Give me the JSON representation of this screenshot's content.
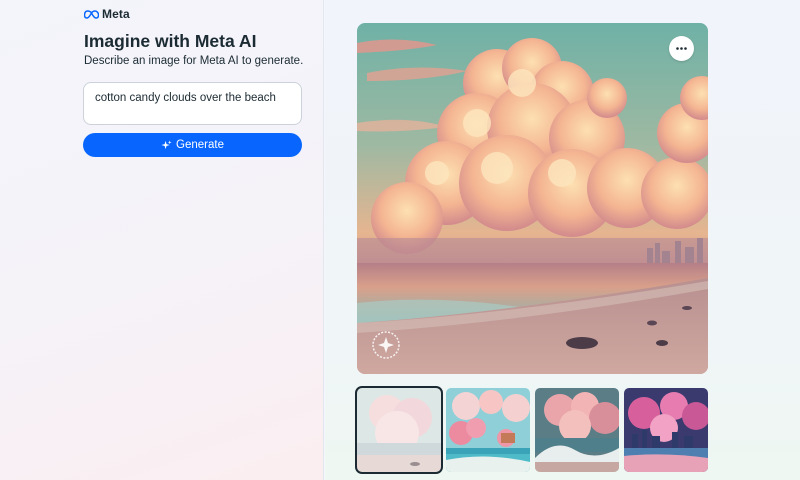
{
  "brand": {
    "logo_text": "Meta",
    "logo_icon": "meta-infinity-icon"
  },
  "header": {
    "title": "Imagine with Meta AI",
    "subtitle": "Describe an image for Meta AI to generate."
  },
  "prompt": {
    "value": "cotton candy clouds over the beach"
  },
  "generate_button": {
    "label": "Generate",
    "icon": "sparkle-icon"
  },
  "main_image": {
    "description_icon": "more-horizontal-icon",
    "watermark_icon": "meta-ai-watermark-icon"
  },
  "thumbnails": [
    {
      "name": "pale-pastel-clouds-beach",
      "selected": true
    },
    {
      "name": "cartoon-pink-trees-beach",
      "selected": false
    },
    {
      "name": "pink-clouds-wave-beach",
      "selected": false
    },
    {
      "name": "pink-clouds-city-beach",
      "selected": false
    }
  ],
  "colors": {
    "accent": "#0866ff",
    "text": "#1c2b33"
  }
}
